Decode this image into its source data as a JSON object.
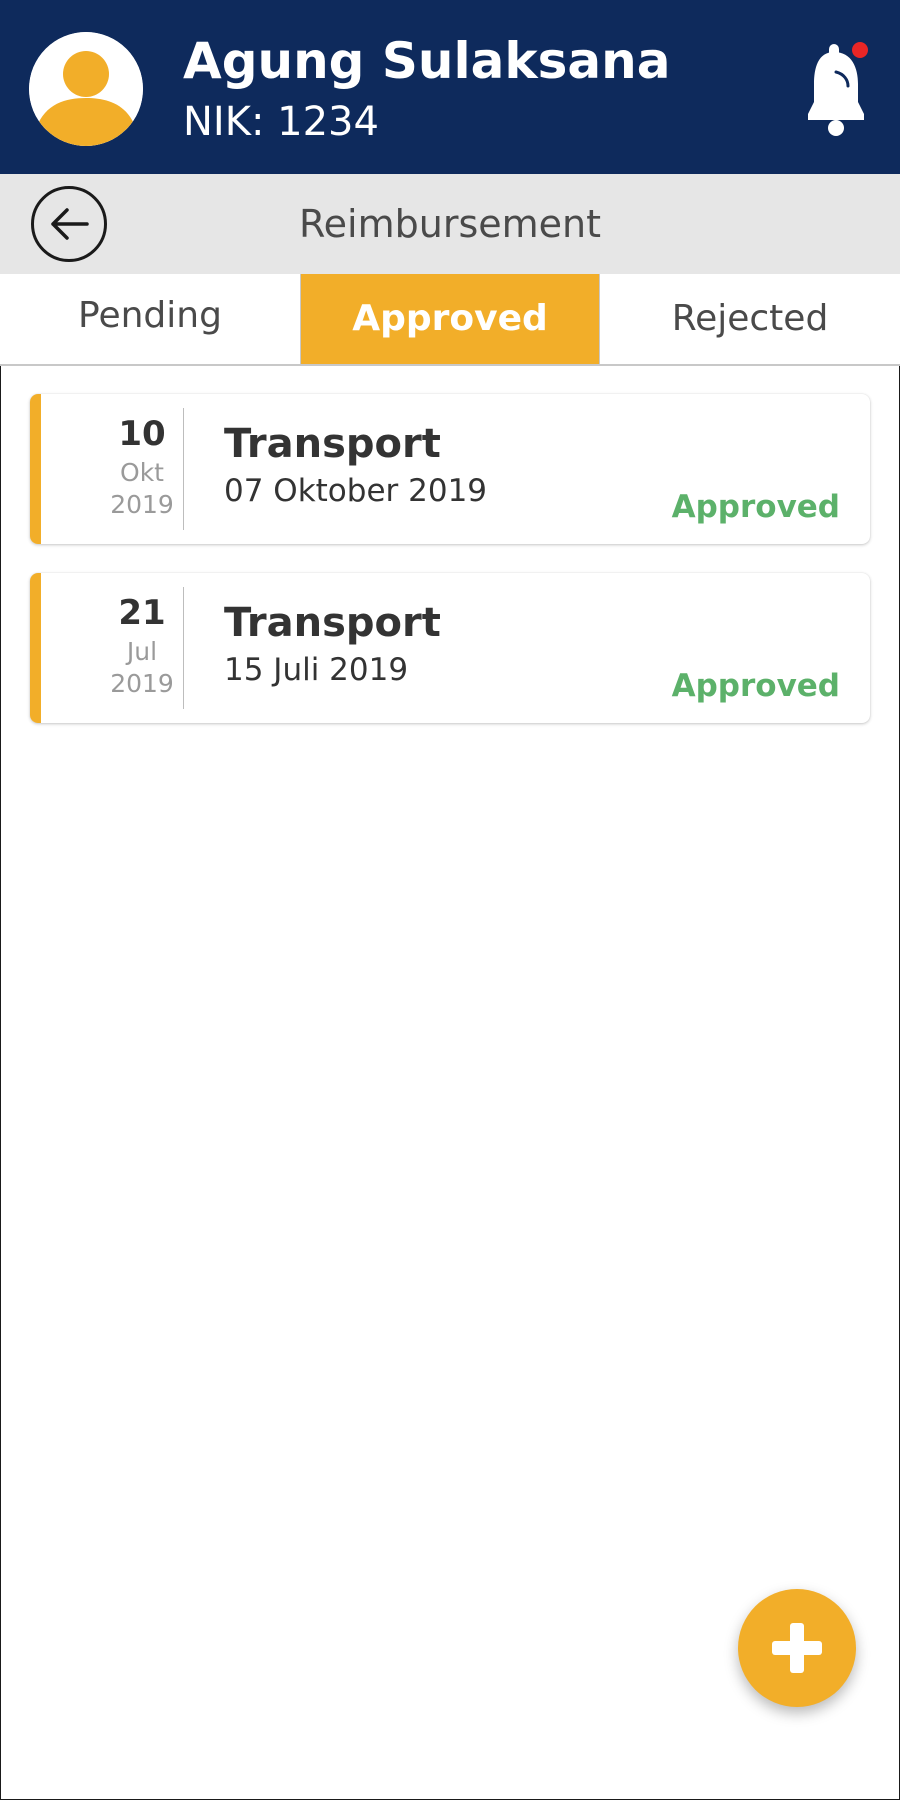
{
  "header": {
    "user_name": "Agung Sulaksana",
    "nik": "NIK: 1234",
    "avatar_icon": "user-avatar-icon",
    "bell_icon": "bell-icon",
    "notification_dot_color": "#e82626"
  },
  "titlebar": {
    "title": "Reimbursement",
    "back_icon": "arrow-left-icon"
  },
  "tabs": [
    {
      "label": "Pending",
      "active": false
    },
    {
      "label": "Approved",
      "active": true
    },
    {
      "label": "Rejected",
      "active": false
    }
  ],
  "items": [
    {
      "day": "10",
      "month": "Okt",
      "year": "2019",
      "title": "Transport",
      "date": "07 Oktober 2019",
      "status": "Approved"
    },
    {
      "day": "21",
      "month": "Jul",
      "year": "2019",
      "title": "Transport",
      "date": "15 Juli 2019",
      "status": "Approved"
    }
  ],
  "fab": {
    "icon": "plus-icon"
  },
  "colors": {
    "header_bg": "#0e2a5c",
    "accent": "#f2ae29",
    "status_approved": "#5cb16a",
    "titlebar_bg": "#e6e6e6"
  }
}
